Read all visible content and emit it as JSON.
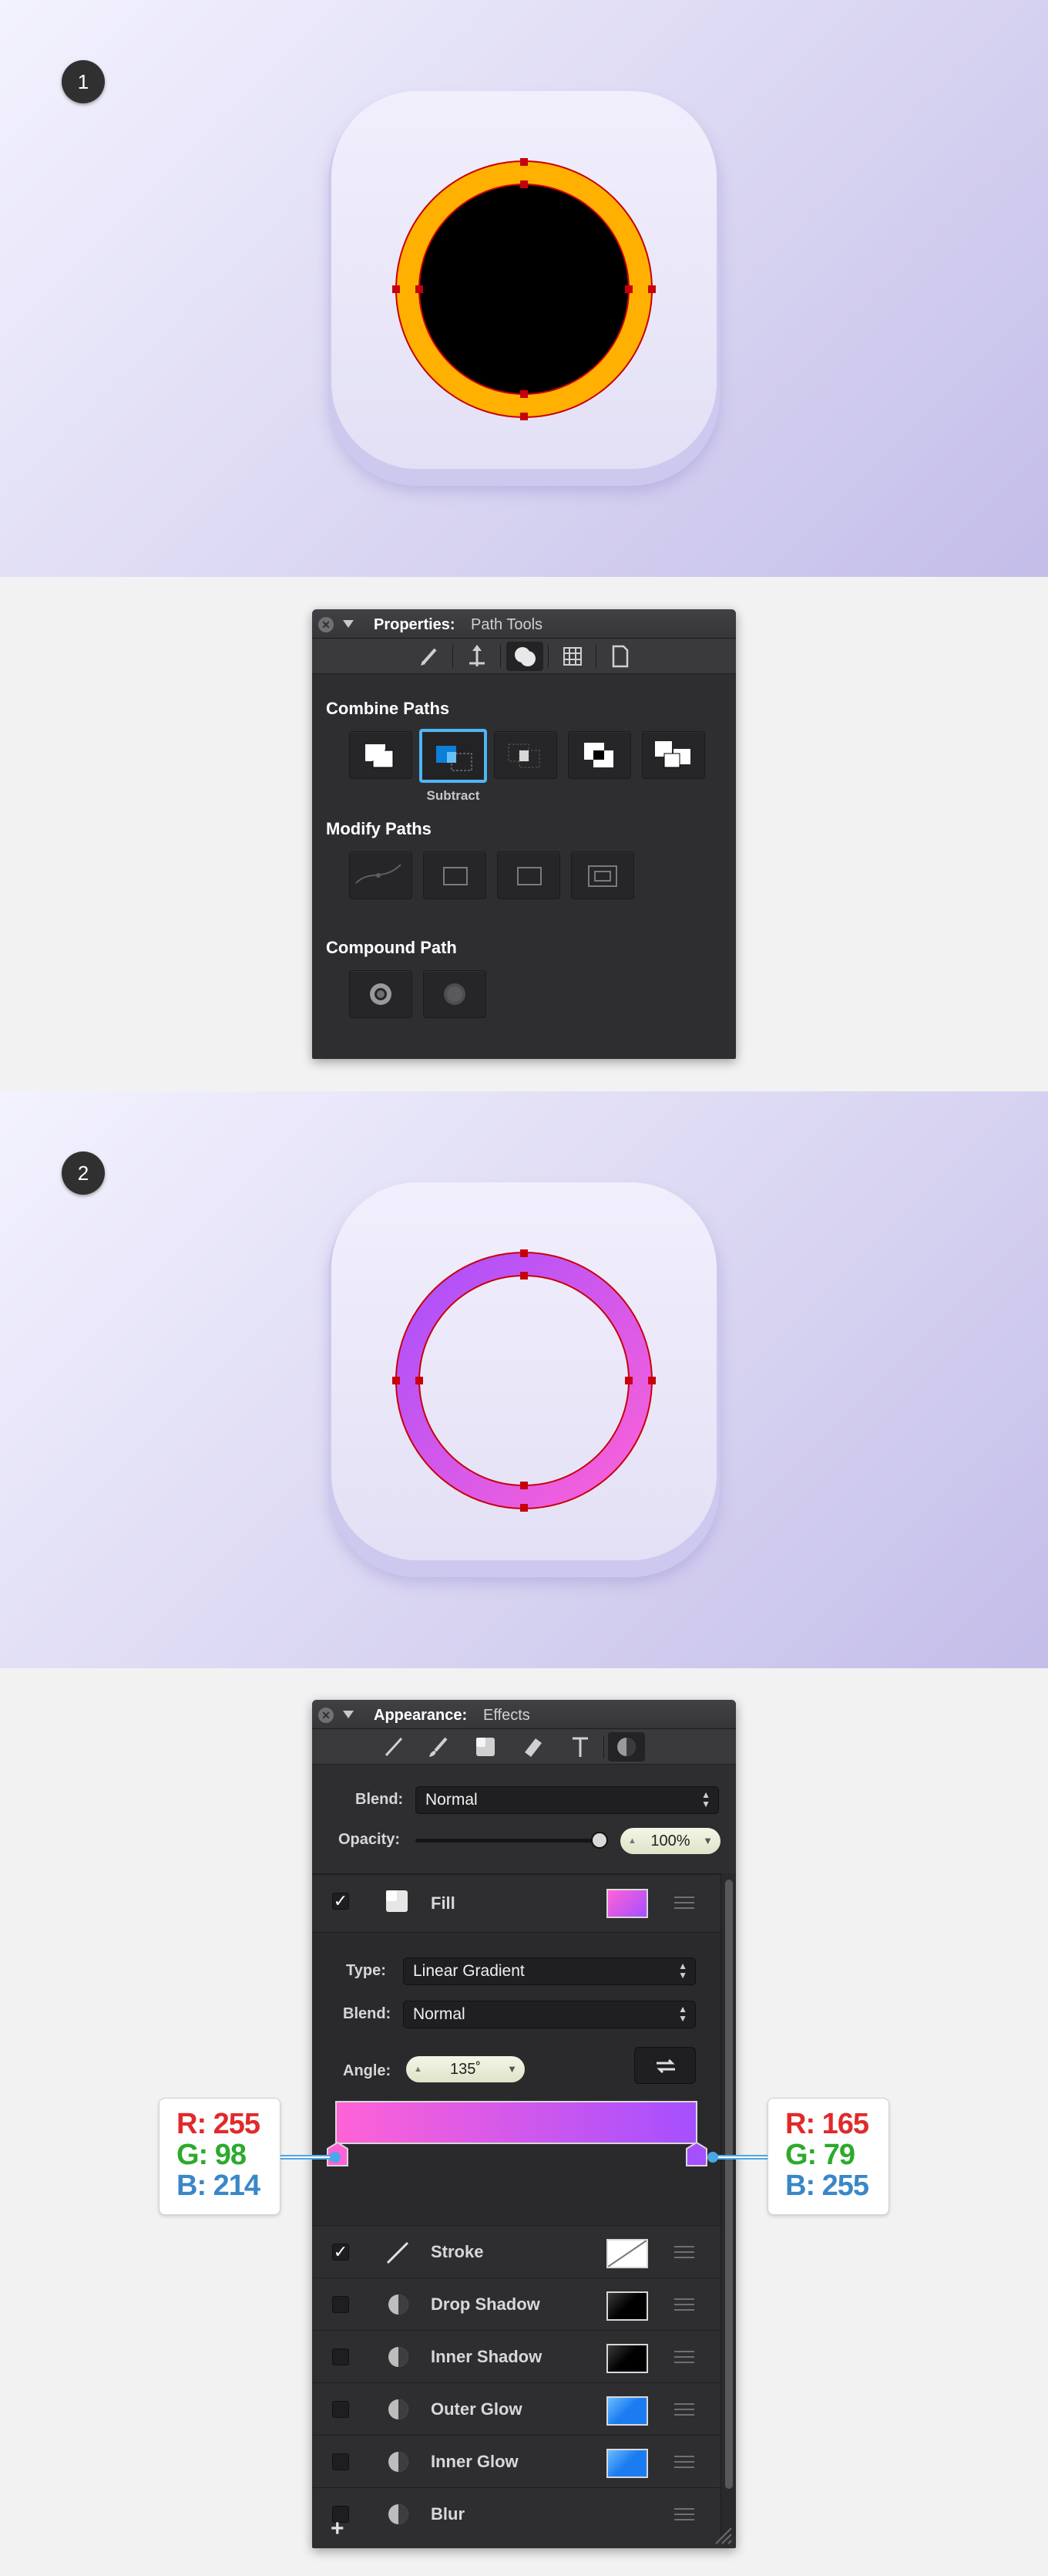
{
  "step1": {
    "badge": "1"
  },
  "step2": {
    "badge": "2"
  },
  "properties_panel": {
    "title": "Properties:",
    "subtitle": "Path Tools",
    "toolbar_icons": [
      "pencil-icon",
      "transform-icon",
      "path-tools-icon",
      "grid-icon",
      "document-icon"
    ],
    "combine_paths": {
      "label": "Combine Paths",
      "buttons": [
        "union-icon",
        "subtract-icon",
        "intersect-icon",
        "exclude-icon",
        "divide-icon"
      ],
      "selected_label": "Subtract"
    },
    "modify_paths": {
      "label": "Modify Paths"
    },
    "compound_path": {
      "label": "Compound Path"
    }
  },
  "appearance_panel": {
    "title": "Appearance:",
    "subtitle": "Effects",
    "blend_label": "Blend:",
    "blend_value": "Normal",
    "opacity_label": "Opacity:",
    "opacity_value": "100%",
    "opacity_fraction": 1.0,
    "fill": {
      "name": "Fill",
      "checked": true,
      "type_label": "Type:",
      "type_value": "Linear Gradient",
      "blend_label": "Blend:",
      "blend_value": "Normal",
      "angle_label": "Angle:",
      "angle_value": "135˚",
      "gradient_start": "#ff62d6",
      "gradient_end": "#a54fff"
    },
    "layers": [
      {
        "name": "Stroke",
        "checked": true,
        "icon": "line-icon"
      },
      {
        "name": "Drop Shadow",
        "checked": false,
        "icon": "effect-icon"
      },
      {
        "name": "Inner Shadow",
        "checked": false,
        "icon": "effect-icon"
      },
      {
        "name": "Outer Glow",
        "checked": false,
        "icon": "effect-icon"
      },
      {
        "name": "Inner Glow",
        "checked": false,
        "icon": "effect-icon"
      },
      {
        "name": "Blur",
        "checked": false,
        "icon": "effect-icon"
      }
    ],
    "add_label": "+"
  },
  "color_stops": {
    "left": {
      "r": "R: 255",
      "g": "G: 98",
      "b": "B: 214"
    },
    "right": {
      "r": "R: 165",
      "g": "G: 79",
      "b": "B: 255"
    }
  },
  "colors": {
    "ring_orange": "#ffb000",
    "anchor_red": "#c8000b",
    "rgb_red": "#e02a2a",
    "rgb_green": "#2caa2c",
    "rgb_blue": "#3a87c8",
    "selection_blue": "#4fb5f4"
  }
}
